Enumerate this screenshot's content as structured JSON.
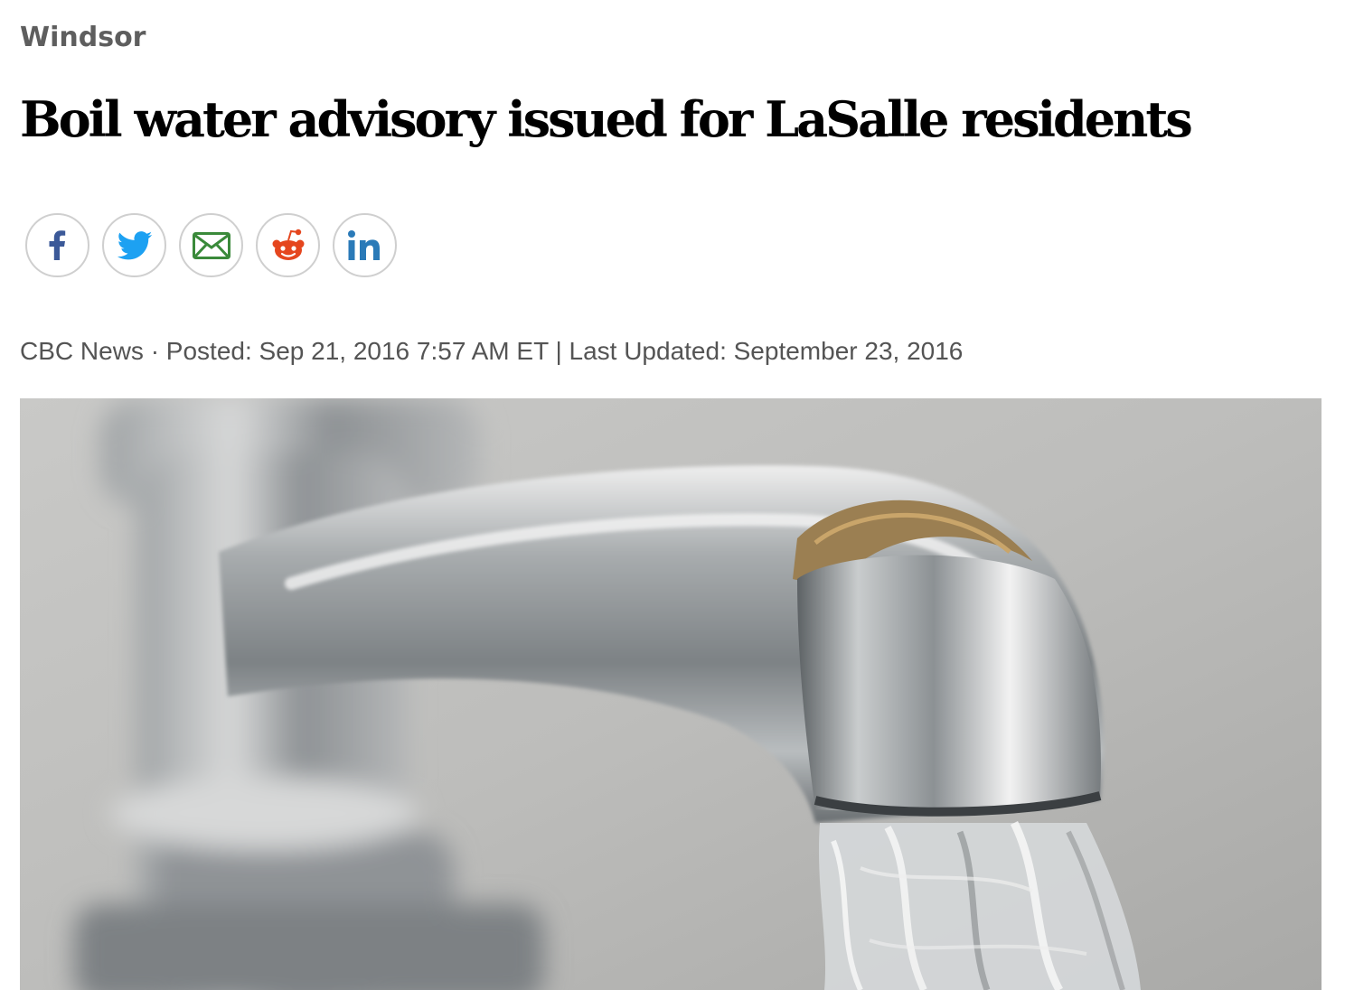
{
  "section": {
    "label": "Windsor"
  },
  "article": {
    "headline": "Boil water advisory issued for LaSalle residents",
    "byline": "CBC News · Posted: Sep 21, 2016 7:57 AM ET | Last Updated: September 23, 2016"
  },
  "share": {
    "buttons": [
      {
        "icon": "facebook-icon",
        "color": "#3b5998"
      },
      {
        "icon": "twitter-icon",
        "color": "#1da1f2"
      },
      {
        "icon": "email-icon",
        "color": "#3a8a3a"
      },
      {
        "icon": "reddit-icon",
        "color": "#e5461e"
      },
      {
        "icon": "linkedin-icon",
        "color": "#2a7ab8"
      }
    ]
  },
  "hero_image": {
    "subject": "chrome-faucet-running-water"
  }
}
